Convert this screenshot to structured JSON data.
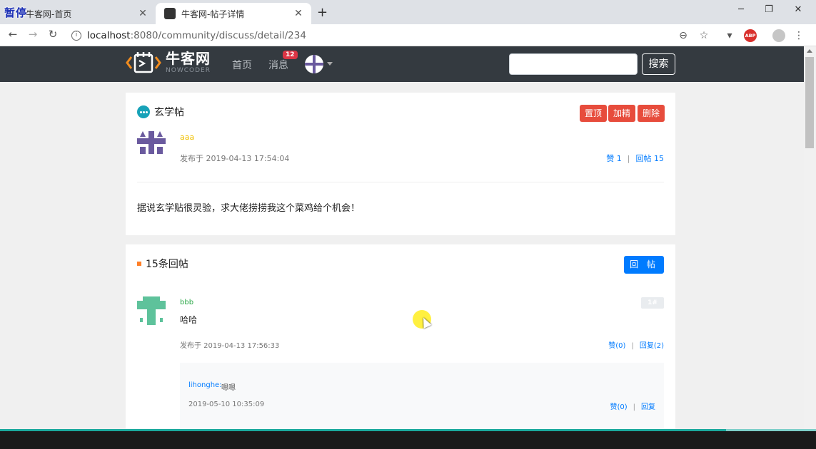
{
  "browser": {
    "tabs": [
      {
        "title": "牛客网-首页",
        "active": false
      },
      {
        "title": "牛客网-帖子详情",
        "active": true
      }
    ],
    "overlay_label": "暂停",
    "url_host": "localhost",
    "url_path": ":8080/community/discuss/detail/234",
    "abp_label": "ABP"
  },
  "site": {
    "logo_cn": "牛客网",
    "logo_en": "NOWCODER",
    "nav": {
      "home": "首页",
      "messages": "消息",
      "message_count": "12"
    },
    "search_placeholder": "",
    "search_button": "搜索"
  },
  "post": {
    "title": "玄学帖",
    "actions": {
      "top": "置顶",
      "wonderful": "加精",
      "delete": "删除"
    },
    "author": "aaa",
    "published_at": "发布于 2019-04-13 17:54:04",
    "likes": "赞 1",
    "reply_count_label": "回帖 15",
    "content": "据说玄学贴很灵验，求大佬捞捞我这个菜鸡给个机会！"
  },
  "replies": {
    "heading": "15条回帖",
    "reply_button": "回 帖",
    "items": [
      {
        "user": "bbb",
        "floor": "1#",
        "content": "哈哈",
        "published_at": "发布于 2019-04-13 17:56:33",
        "likes": "赞(0)",
        "reply_label": "回复(2)",
        "sub_replies": [
          {
            "user": "lihonghe:",
            "content": "嗯嗯",
            "time": "2019-05-10 10:35:09",
            "likes": "赞(0)",
            "reply_label": "回复"
          }
        ]
      }
    ]
  },
  "colors": {
    "header_bg": "#343a40",
    "danger": "#e74c3c",
    "primary": "#007bff",
    "progress": "#1ba99d"
  },
  "video_progress": 0.89
}
